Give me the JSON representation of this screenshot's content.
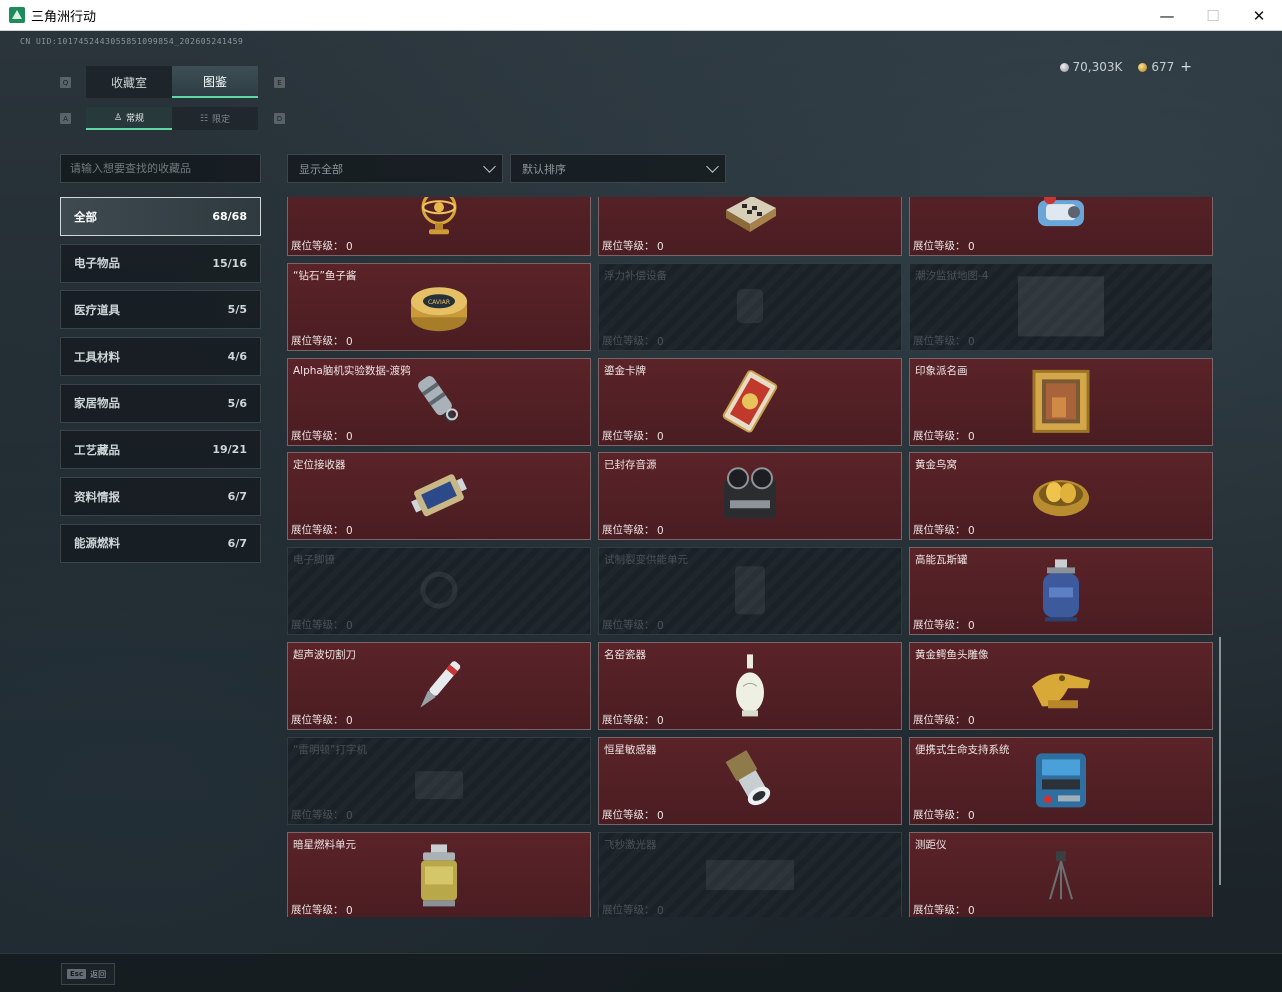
{
  "window": {
    "title": "三角洲行动",
    "minimize": "—",
    "maximize": "☐",
    "close": "✕"
  },
  "header": {
    "uid": "CN UID:1017452443055851099854_202605241459",
    "currency_silver": "70,303K",
    "currency_gold": "677",
    "add_label": "+"
  },
  "tabs": [
    {
      "label": "收藏室",
      "active": false
    },
    {
      "label": "图鉴",
      "active": true
    }
  ],
  "subtabs": [
    {
      "label": "常规",
      "active": true
    },
    {
      "label": "限定",
      "active": false
    }
  ],
  "keyhints": {
    "tab_left": "Q",
    "tab_right": "E",
    "sub_left": "A",
    "sub_right": "D"
  },
  "search": {
    "placeholder": "请输入想要查找的收藏品"
  },
  "filters": {
    "display": "显示全部",
    "sort": "默认排序"
  },
  "categories": [
    {
      "name": "全部",
      "count": "68/68",
      "active": true
    },
    {
      "name": "电子物品",
      "count": "15/16"
    },
    {
      "name": "医疗道具",
      "count": "5/5"
    },
    {
      "name": "工具材料",
      "count": "4/6"
    },
    {
      "name": "家居物品",
      "count": "5/6"
    },
    {
      "name": "工艺藏品",
      "count": "19/21"
    },
    {
      "name": "资料情报",
      "count": "6/7"
    },
    {
      "name": "能源燃料",
      "count": "6/7"
    }
  ],
  "level_label": "展位等级：",
  "items": [
    {
      "name": "",
      "level": "0",
      "locked": false,
      "icon": "armillary-sphere-icon"
    },
    {
      "name": "",
      "level": "0",
      "locked": false,
      "icon": "chess-box-icon"
    },
    {
      "name": "",
      "level": "0",
      "locked": false,
      "icon": "mech-device-icon"
    },
    {
      "name": "“钻石”鱼子酱",
      "level": "0",
      "locked": false,
      "icon": "caviar-tin-icon"
    },
    {
      "name": "浮力补偿设备",
      "level": "0",
      "locked": true,
      "icon": "buoyancy-device-icon"
    },
    {
      "name": "潮汐监狱地图-4",
      "level": "0",
      "locked": true,
      "icon": "map-icon"
    },
    {
      "name": "Alpha脑机实验数据-渡鸦",
      "level": "0",
      "locked": false,
      "icon": "data-capsule-icon"
    },
    {
      "name": "鎏金卡牌",
      "level": "0",
      "locked": false,
      "icon": "gilded-card-icon"
    },
    {
      "name": "印象派名画",
      "level": "0",
      "locked": false,
      "icon": "painting-icon"
    },
    {
      "name": "定位接收器",
      "level": "0",
      "locked": false,
      "icon": "receiver-icon"
    },
    {
      "name": "已封存音源",
      "level": "0",
      "locked": false,
      "icon": "tape-recorder-icon"
    },
    {
      "name": "黄金鸟窝",
      "level": "0",
      "locked": false,
      "icon": "golden-nest-icon"
    },
    {
      "name": "电子脚镣",
      "level": "0",
      "locked": true,
      "icon": "ankle-monitor-icon"
    },
    {
      "name": "试制裂变供能单元",
      "level": "0",
      "locked": true,
      "icon": "fission-unit-icon"
    },
    {
      "name": "高能瓦斯罐",
      "level": "0",
      "locked": false,
      "icon": "gas-canister-icon"
    },
    {
      "name": "超声波切割刀",
      "level": "0",
      "locked": false,
      "icon": "ultrasonic-knife-icon"
    },
    {
      "name": "名窑瓷器",
      "level": "0",
      "locked": false,
      "icon": "porcelain-vase-icon"
    },
    {
      "name": "黄金鳄鱼头雕像",
      "level": "0",
      "locked": false,
      "icon": "gold-crocodile-icon"
    },
    {
      "name": "“雷明顿”打字机",
      "level": "0",
      "locked": true,
      "icon": "typewriter-icon"
    },
    {
      "name": "恒星敏感器",
      "level": "0",
      "locked": false,
      "icon": "star-sensor-icon"
    },
    {
      "name": "便携式生命支持系统",
      "level": "0",
      "locked": false,
      "icon": "life-support-icon"
    },
    {
      "name": "暗星燃料单元",
      "level": "0",
      "locked": false,
      "icon": "fuel-cell-icon"
    },
    {
      "name": "飞秒激光器",
      "level": "0",
      "locked": true,
      "icon": "laser-icon"
    },
    {
      "name": "测距仪",
      "level": "0",
      "locked": false,
      "icon": "rangefinder-icon"
    }
  ],
  "footer": {
    "esc_key": "Esc",
    "esc_label": "返回"
  }
}
